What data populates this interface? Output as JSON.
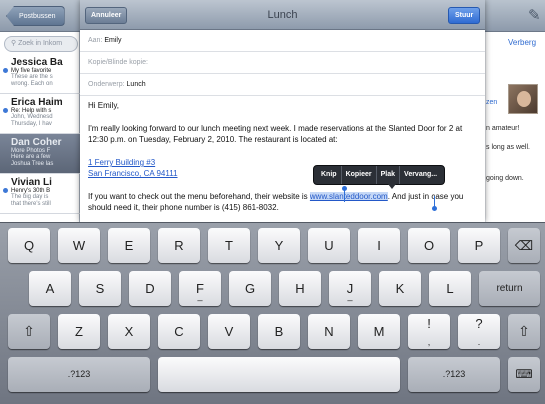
{
  "background": {
    "mailbox_button": "Postbussen",
    "search_placeholder": "Zoek in Inkom",
    "messages": [
      {
        "sender": "Jessica Ba",
        "subject": "My five favorite",
        "preview1": "These are the s",
        "preview2": "wrong. Each on",
        "unread": true
      },
      {
        "sender": "Erica Haim",
        "subject": "Re: Help with s",
        "preview1": "John, Wednesd",
        "preview2": "Thursday, I hav",
        "unread": true
      },
      {
        "sender": "Dan Coher",
        "subject": "More Photos F",
        "preview1": "Here are a few",
        "preview2": "Joshua Tree las",
        "unread": false
      },
      {
        "sender": "Vivian Li",
        "subject": "Henry's 30th B",
        "preview1": "The big day is",
        "preview2": "that there's still",
        "unread": true
      }
    ],
    "detail": {
      "hide_label": "Verberg",
      "name_fragment": "zen",
      "line1": "n amateur!",
      "line2": "s long as well.",
      "line3": "going down."
    }
  },
  "compose": {
    "cancel_label": "Annuleer",
    "title": "Lunch",
    "send_label": "Stuur",
    "to_label": "Aan:",
    "to_value": "Emily",
    "cc_label": "Kopie/Blinde kopie:",
    "subject_label": "Onderwerp:",
    "subject_value": "Lunch",
    "greeting": "Hi Emily,",
    "para1": "I'm really looking forward to our lunch meeting next week. I made reservations at the Slanted Door for 2 at 12:30 p.m. on Tuesday, February 2, 2010. The restaurant is located at:",
    "address1": "1 Ferry Building #3",
    "address2": "San Francisco, CA 94111",
    "para2_pre": "If you want to check out the menu beforehand, their website is ",
    "website": "www.slanteddoor.com",
    "para2_post": ". And just in case you should need it, their phone number is (415) 861-8032."
  },
  "edit_menu": [
    "Knip",
    "Kopieer",
    "Plak",
    "Vervang..."
  ],
  "keyboard": {
    "row1": [
      "Q",
      "W",
      "E",
      "R",
      "T",
      "Y",
      "U",
      "I",
      "O",
      "P"
    ],
    "row2": [
      "A",
      "S",
      "D",
      "F",
      "G",
      "H",
      "J",
      "K",
      "L"
    ],
    "row2_underscores": {
      "F": "_",
      "J": "_"
    },
    "return_label": "return",
    "row3": [
      "Z",
      "X",
      "C",
      "V",
      "B",
      "N",
      "M"
    ],
    "excl_top": "!",
    "excl_bottom": ",",
    "quest_top": "?",
    "quest_bottom": ".",
    "numbers_label": ".?123",
    "icons": {
      "delete": "backspace-icon",
      "shift": "shift-icon",
      "hide_keyboard": "keyboard-hide-icon"
    }
  }
}
